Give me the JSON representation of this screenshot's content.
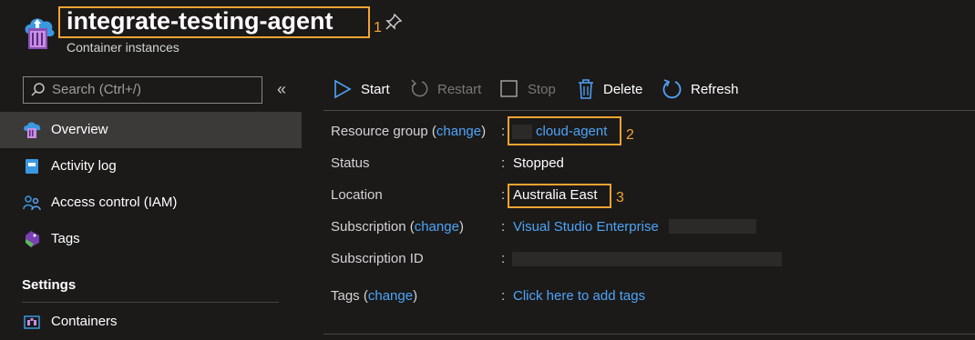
{
  "header": {
    "title": "integrate-testing-agent",
    "subtitle": "Container instances",
    "callout_1": "1",
    "app_icon": "container-instances-icon",
    "pin_icon": "pin-icon"
  },
  "sidebar": {
    "search_placeholder": "Search (Ctrl+/)",
    "collapse_glyph": "«",
    "items": [
      {
        "label": "Overview",
        "icon": "overview-icon"
      },
      {
        "label": "Activity log",
        "icon": "activity-log-icon"
      },
      {
        "label": "Access control (IAM)",
        "icon": "iam-icon"
      },
      {
        "label": "Tags",
        "icon": "tag-icon"
      }
    ],
    "settings_header": "Settings",
    "settings_items": [
      {
        "label": "Containers",
        "icon": "containers-icon"
      }
    ]
  },
  "toolbar": {
    "start": "Start",
    "restart": "Restart",
    "stop": "Stop",
    "delete": "Delete",
    "refresh": "Refresh"
  },
  "essentials": {
    "resource_group_key": "Resource group",
    "resource_group_change": "change",
    "resource_group_value": "cloud-agent",
    "callout_2": "2",
    "status_key": "Status",
    "status_value": "Stopped",
    "location_key": "Location",
    "location_value": "Australia East",
    "callout_3": "3",
    "subscription_key": "Subscription",
    "subscription_change": "change",
    "subscription_value": "Visual Studio Enterprise",
    "subscription_id_key": "Subscription ID",
    "tags_key": "Tags",
    "tags_change": "change",
    "tags_value": "Click here to add tags",
    "colon": ":",
    "open_paren": "(",
    "close_paren": ")"
  },
  "colors": {
    "accent": "#4fa3f7",
    "highlight": "#f4a431",
    "background": "#1b1a19"
  }
}
